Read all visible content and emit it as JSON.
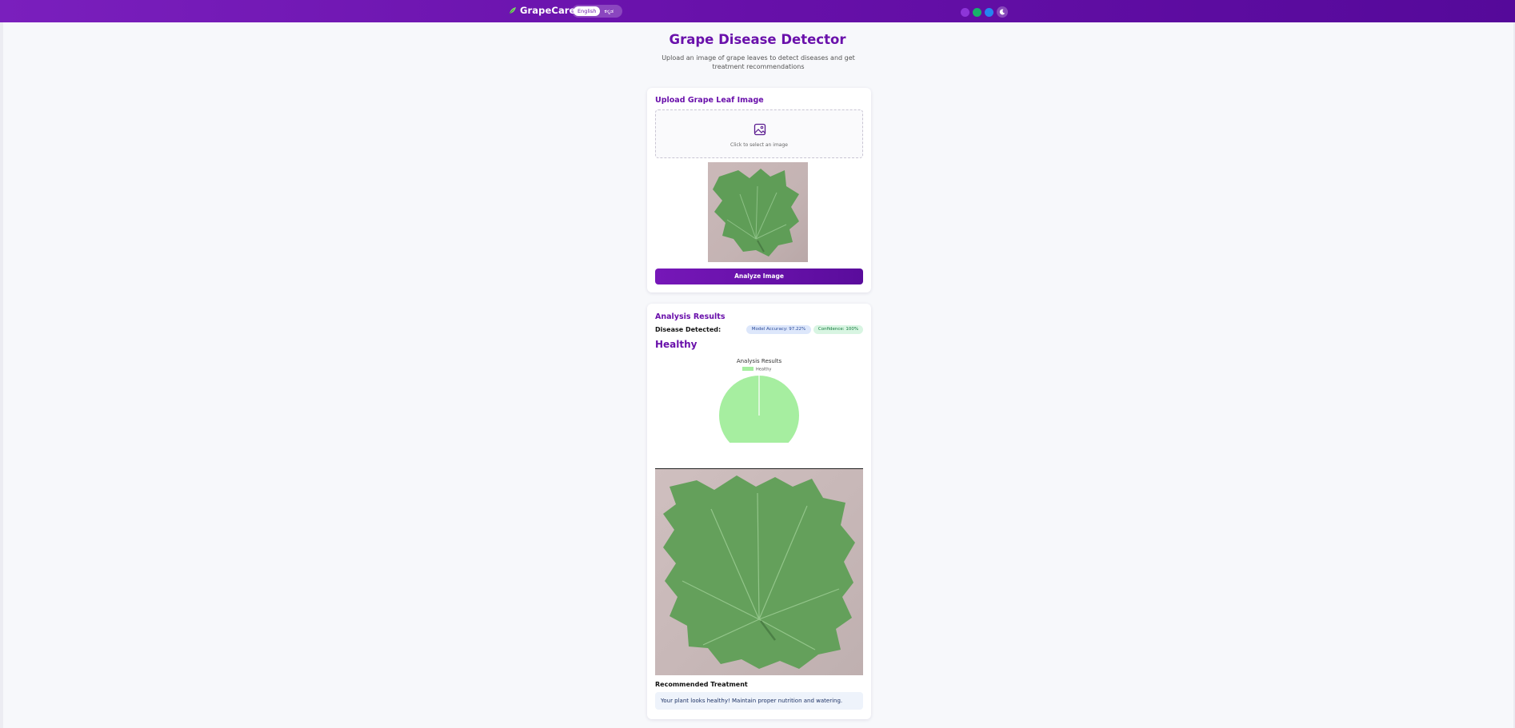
{
  "navbar": {
    "brand": "GrapeCare",
    "languages": [
      {
        "label": "English",
        "active": true
      },
      {
        "label": "ಕನ್ನಡ",
        "active": false
      }
    ],
    "theme_colors": [
      "#8d35d8",
      "#17b26a",
      "#2585f0"
    ],
    "dark_mode_icon": "moon-icon"
  },
  "header": {
    "title": "Grape Disease Detector",
    "subtitle": "Upload an image of grape leaves to detect diseases and get treatment recommendations"
  },
  "upload": {
    "title": "Upload Grape Leaf Image",
    "hint": "Click to select an image",
    "icon": "image-icon",
    "analyze_label": "Analyze Image"
  },
  "results": {
    "title": "Analysis Results",
    "detected_label": "Disease Detected:",
    "accuracy_badge": "Model Accuracy: 97.22%",
    "confidence_badge": "Confidence: 100%",
    "disease": "Healthy",
    "treatment_title": "Recommended Treatment",
    "treatment_text": "Your plant looks healthy! Maintain proper nutrition and watering."
  },
  "chart_data": {
    "type": "pie",
    "title": "Analysis Results",
    "legend_position": "top",
    "categories": [
      "Healthy"
    ],
    "values": [
      100
    ],
    "colors": [
      "#a6eea0"
    ]
  },
  "colors": {
    "accent": "#6a11ab",
    "navbar_start": "#7a1fbd",
    "navbar_end": "#55099a",
    "background": "#f7f8fb"
  }
}
